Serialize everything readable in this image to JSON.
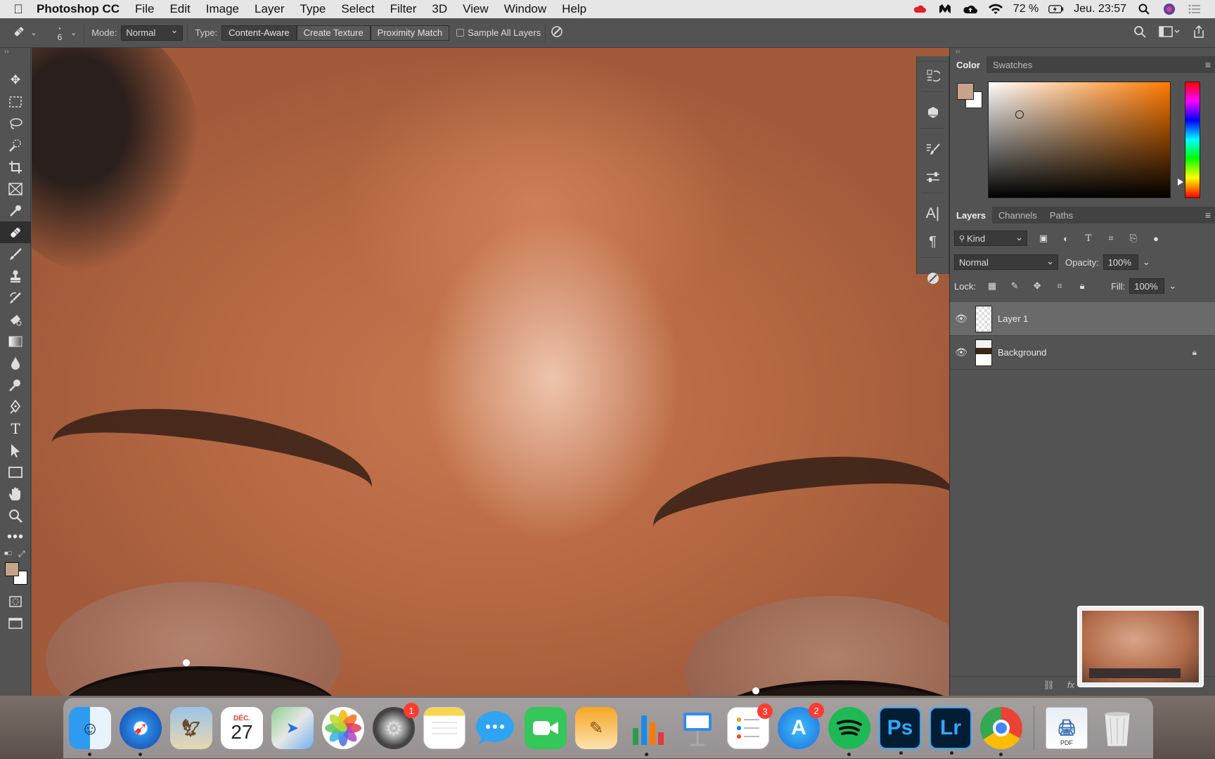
{
  "menubar": {
    "app_name": "Photoshop CC",
    "items": [
      "File",
      "Edit",
      "Image",
      "Layer",
      "Type",
      "Select",
      "Filter",
      "3D",
      "View",
      "Window",
      "Help"
    ],
    "battery": "72 %",
    "clock": "Jeu. 23:57"
  },
  "options": {
    "brush_size": "6",
    "mode_label": "Mode:",
    "mode_value": "Normal",
    "type_label": "Type:",
    "type_buttons": [
      "Content-Aware",
      "Create Texture",
      "Proximity Match"
    ],
    "sample_all_layers": "Sample All Layers"
  },
  "color_panel": {
    "tabs": [
      "Color",
      "Swatches"
    ],
    "foreground": "#c5a48b",
    "background": "#ffffff"
  },
  "layers_panel": {
    "tabs": [
      "Layers",
      "Channels",
      "Paths"
    ],
    "filter_kind": "Kind",
    "blend_mode": "Normal",
    "opacity_label": "Opacity:",
    "opacity_value": "100%",
    "lock_label": "Lock:",
    "fill_label": "Fill:",
    "fill_value": "100%",
    "layers": [
      {
        "name": "Layer 1"
      },
      {
        "name": "Background"
      }
    ],
    "footer_fx": "fx"
  },
  "dock": {
    "calendar_month": "DÉC.",
    "calendar_day": "27",
    "system_prefs_badge": "1",
    "reminders_badge": "3",
    "appstore_badge": "2",
    "ps_label": "Ps",
    "lr_label": "Lr",
    "pdf_label": "PDF"
  }
}
